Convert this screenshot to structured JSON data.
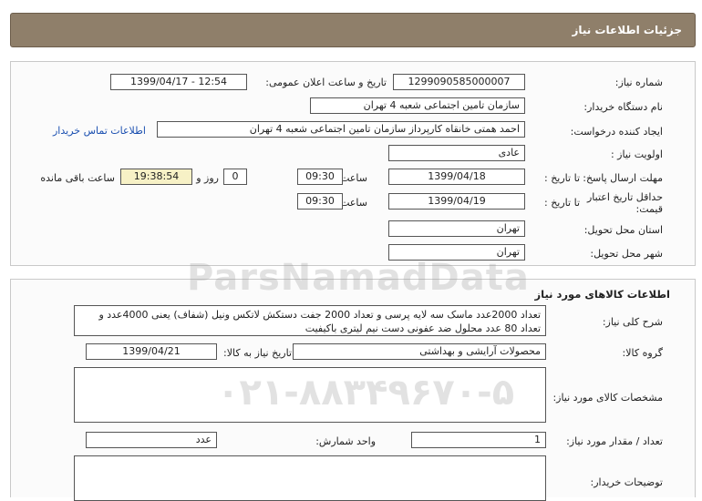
{
  "header": {
    "title": "جزئیات اطلاعات نیاز"
  },
  "need_info": {
    "need_number_label": "شماره نیاز:",
    "need_number": "1299090585000007",
    "announce_label": "تاریخ و ساعت اعلان عمومی:",
    "announce_value": "1399/04/17 - 12:54",
    "buyer_org_label": "نام دستگاه خریدار:",
    "buyer_org": "سازمان تامین اجتماعی شعبه 4 تهران",
    "requester_label": "ایجاد کننده درخواست:",
    "requester": "احمد همتی خانقاه کارپرداز سازمان تامین اجتماعی شعبه 4 تهران",
    "contact_link": "اطلاعات تماس خریدار",
    "priority_label": "اولویت نیاز :",
    "priority": "عادی",
    "reply_deadline_label": "مهلت ارسال پاسخ:",
    "to_date_label": "تا تاریخ :",
    "reply_date": "1399/04/18",
    "time_label": "ساعت",
    "reply_time": "09:30",
    "days_value": "0",
    "days_label": "روز و",
    "remaining_time": "19:38:54",
    "remaining_label": "ساعت باقی مانده",
    "price_validity_label_1": "حداقل تاریخ اعتبار",
    "price_validity_label_2": "قیمت:",
    "validity_date": "1399/04/19",
    "validity_time": "09:30",
    "province_label": "استان محل تحویل:",
    "province": "تهران",
    "city_label": "شهر محل تحویل:",
    "city": "تهران"
  },
  "goods": {
    "section_title": "اطلاعات کالاهای مورد نیاز",
    "description_label": "شرح کلی نیاز:",
    "description": "تعداد 2000عدد ماسک سه لایه پرسی و تعداد 2000 جفت دستکش لاتکس ونیل (شفاف) یعنی 4000عدد و تعداد 80 عدد محلول ضد عفونی دست نیم لیتری باکیفیت",
    "group_label": "گروه کالا:",
    "group": "محصولات آرایشی و بهداشتی",
    "need_date_label": "تاریخ نیاز به کالا:",
    "need_date": "1399/04/21",
    "specs_label": "مشخصات کالای مورد نیاز:",
    "specs": "",
    "quantity_label": "تعداد / مقدار مورد نیاز:",
    "quantity": "1",
    "unit_label": "واحد شمارش:",
    "unit": "عدد",
    "buyer_notes_label": "توضیحات خریدار:",
    "buyer_notes": ""
  },
  "watermark": {
    "brand": "ParsNamadData",
    "phone": "۰۲۱-۸۸۳۴۹۶۷۰-۵"
  }
}
